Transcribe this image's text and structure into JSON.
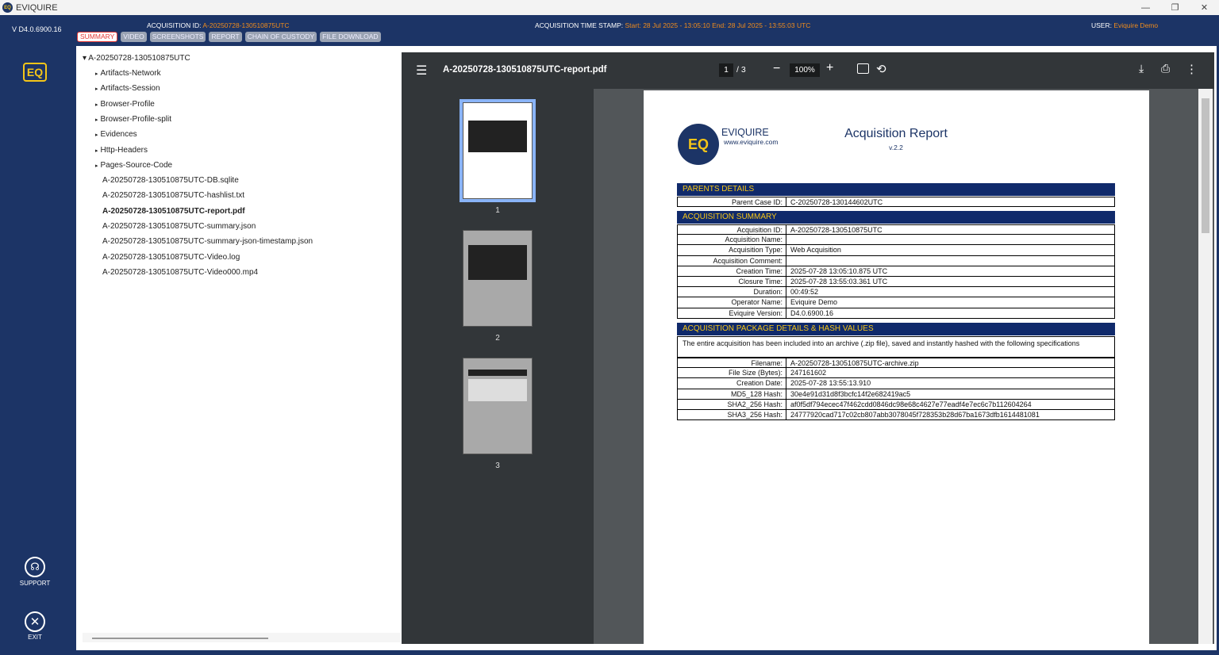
{
  "window": {
    "title": "EVIQUIRE",
    "minimize": "—",
    "restore": "❐",
    "close": "✕",
    "app_icon_text": "EQ"
  },
  "header": {
    "version": "V D4.0.6900.16",
    "acq_id_label": "ACQUISITION ID:",
    "acq_id_value": "A-20250728-130510875UTC",
    "ts_label": "ACQUISITION TIME STAMP:",
    "ts_value": "Start: 28 Jul 2025 - 13:05:10 End: 28 Jul 2025 - 13:55:03 UTC",
    "user_label": "USER:",
    "user_value": "Eviquire Demo",
    "tabs": [
      {
        "label": "SUMMARY",
        "active": true
      },
      {
        "label": "VIDEO"
      },
      {
        "label": "SCREENSHOTS"
      },
      {
        "label": "REPORT"
      },
      {
        "label": "CHAIN OF CUSTODY"
      },
      {
        "label": "FILE DOWNLOAD"
      }
    ]
  },
  "sidebar": {
    "logo": "EQ",
    "support_label": "SUPPORT",
    "exit_label": "EXIT",
    "support_icon": "headset-icon",
    "exit_icon": "close-circle-icon"
  },
  "tree": {
    "root": "A-20250728-130510875UTC",
    "root_arrow": "▾",
    "folder_arrow": "▸",
    "folders": [
      "Artifacts-Network",
      "Artifacts-Session",
      "Browser-Profile",
      "Browser-Profile-split",
      "Evidences",
      "Http-Headers",
      "Pages-Source-Code"
    ],
    "files": [
      {
        "name": "A-20250728-130510875UTC-DB.sqlite"
      },
      {
        "name": "A-20250728-130510875UTC-hashlist.txt"
      },
      {
        "name": "A-20250728-130510875UTC-report.pdf",
        "selected": true
      },
      {
        "name": "A-20250728-130510875UTC-summary.json"
      },
      {
        "name": "A-20250728-130510875UTC-summary-json-timestamp.json"
      },
      {
        "name": "A-20250728-130510875UTC-Video.log"
      },
      {
        "name": "A-20250728-130510875UTC-Video000.mp4"
      }
    ]
  },
  "pdf": {
    "filename": "A-20250728-130510875UTC-report.pdf",
    "page": "1",
    "total": "/ 3",
    "zoom": "100%",
    "icons": {
      "menu": "☰",
      "minus": "−",
      "plus": "+",
      "rotate": "⟲",
      "download": "⤓",
      "print": "⎙",
      "more": "⋮"
    },
    "thumb_numbers": [
      "1",
      "2",
      "3"
    ]
  },
  "report": {
    "logo_text": "EQ",
    "brand": "EVIQUIRE",
    "url": "www.eviquire.com",
    "title": "Acquisition Report",
    "version": "v.2.2",
    "parents_title": "PARENTS DETAILS",
    "parents": [
      {
        "k": "Parent Case ID:",
        "v": "C-20250728-130144602UTC"
      }
    ],
    "summary_title": "ACQUISITION SUMMARY",
    "summary": [
      {
        "k": "Acquisition ID:",
        "v": "A-20250728-130510875UTC"
      },
      {
        "k": "Acquisition Name:",
        "v": ""
      },
      {
        "k": "Acquisition Type:",
        "v": "Web Acquisition"
      },
      {
        "k": "Acquisition Comment:",
        "v": ""
      },
      {
        "k": "Creation Time:",
        "v": "2025-07-28 13:05:10.875 UTC"
      },
      {
        "k": "Closure Time:",
        "v": "2025-07-28 13:55:03.361 UTC"
      },
      {
        "k": "Duration:",
        "v": "00:49:52"
      },
      {
        "k": "Operator Name:",
        "v": "Eviquire Demo"
      },
      {
        "k": "Eviquire Version:",
        "v": "D4.0.6900.16"
      }
    ],
    "package_title": "ACQUISITION PACKAGE DETAILS & HASH VALUES",
    "package_desc": "The entire acquisition has been included into an archive (.zip file), saved and instantly hashed with the following specifications",
    "package": [
      {
        "k": "Filename:",
        "v": "A-20250728-130510875UTC-archive.zip"
      },
      {
        "k": "File Size (Bytes):",
        "v": "247161602"
      },
      {
        "k": "Creation Date:",
        "v": "2025-07-28 13:55:13.910"
      },
      {
        "k": "MD5_128 Hash:",
        "v": "30e4e91d31d8f3bcfc14f2e682419ac5"
      },
      {
        "k": "SHA2_256 Hash:",
        "v": "af0f5df794ecec47f462cdd0846dc98e68c4627e77eadf4e7ec6c7b112604264"
      },
      {
        "k": "SHA3_256 Hash:",
        "v": "24777920cad717c02cb807abb3078045f728353b28d67ba1673dfb1614481081"
      }
    ]
  }
}
